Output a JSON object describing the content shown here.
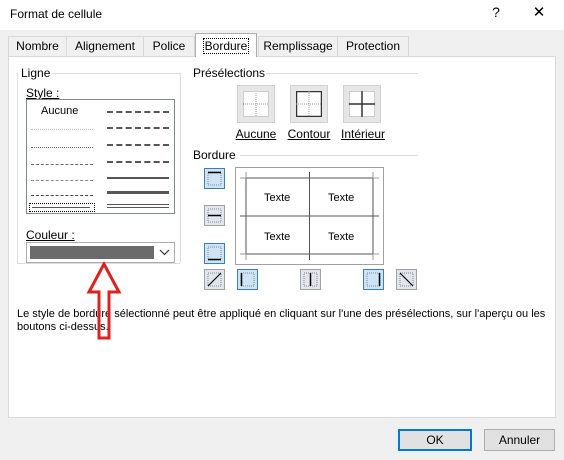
{
  "window": {
    "title": "Format de cellule",
    "help_glyph": "?",
    "close_glyph": "✕"
  },
  "tabs": [
    {
      "label": "Nombre"
    },
    {
      "label": "Alignement"
    },
    {
      "label": "Police"
    },
    {
      "label": "Bordure",
      "active": true
    },
    {
      "label": "Remplissage"
    },
    {
      "label": "Protection"
    }
  ],
  "ligne": {
    "group_label": "Ligne",
    "style_label": "Style :",
    "style_none": "Aucune",
    "color_label": "Couleur :",
    "color_value": "#6b6b6b"
  },
  "presets": {
    "group_label": "Présélections",
    "items": [
      {
        "label": "Aucune",
        "icon": "preset-none-icon"
      },
      {
        "label": "Contour",
        "icon": "preset-outline-icon"
      },
      {
        "label": "Intérieur",
        "icon": "preset-inside-icon"
      }
    ]
  },
  "bordure": {
    "group_label": "Bordure",
    "preview_cells": [
      "Texte",
      "Texte",
      "Texte",
      "Texte"
    ]
  },
  "description": "Le style de bordure sélectionné peut être appliqué en cliquant sur l'une des présélections, sur l'aperçu ou les boutons ci-dessus.",
  "annotation": {
    "arrow_color": "#e0201f"
  },
  "footer": {
    "ok_label": "OK",
    "cancel_label": "Annuler"
  }
}
